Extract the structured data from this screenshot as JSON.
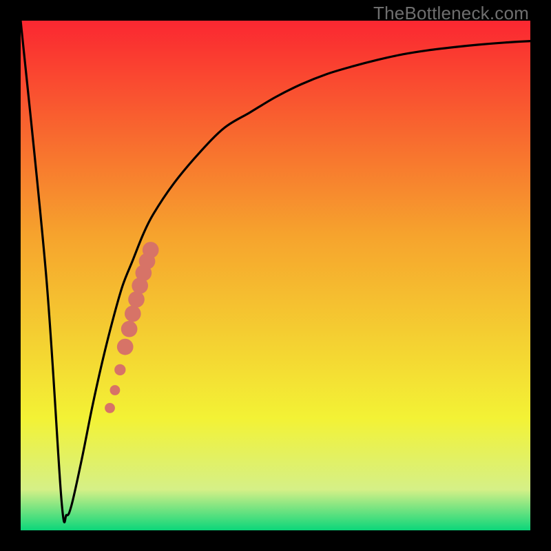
{
  "watermark": "TheBottleneck.com",
  "colors": {
    "curve": "#000000",
    "marker_fill": "#d77367",
    "gradient_top": "#fb2731",
    "gradient_mid1": "#f6a32d",
    "gradient_mid2": "#f3f235",
    "gradient_mid3": "#d5f087",
    "gradient_bottom": "#0bd67a"
  },
  "chart_data": {
    "type": "line",
    "title": "",
    "xlabel": "",
    "ylabel": "",
    "xlim": [
      0,
      100
    ],
    "ylim": [
      0,
      100
    ],
    "grid": false,
    "legend": false,
    "series": [
      {
        "name": "bottleneck-curve",
        "x": [
          0,
          5,
          8,
          9,
          10,
          12,
          14,
          16,
          18,
          20,
          22,
          24,
          26,
          30,
          35,
          40,
          45,
          50,
          55,
          60,
          65,
          70,
          75,
          80,
          85,
          90,
          95,
          100
        ],
        "y": [
          100,
          50,
          6,
          3,
          5,
          14,
          24,
          33,
          41,
          48,
          53,
          58,
          62,
          68,
          74,
          79,
          82,
          85,
          87.5,
          89.5,
          91,
          92.3,
          93.4,
          94.2,
          94.8,
          95.3,
          95.7,
          96
        ]
      }
    ],
    "markers": [
      {
        "name": "highlight-segment",
        "shape": "circle",
        "points": [
          {
            "x": 17.5,
            "y": 24.0,
            "r": 1.0
          },
          {
            "x": 18.5,
            "y": 27.5,
            "r": 1.0
          },
          {
            "x": 19.5,
            "y": 31.5,
            "r": 1.1
          },
          {
            "x": 20.5,
            "y": 36.0,
            "r": 1.6
          },
          {
            "x": 21.3,
            "y": 39.5,
            "r": 1.6
          },
          {
            "x": 22.0,
            "y": 42.5,
            "r": 1.6
          },
          {
            "x": 22.7,
            "y": 45.3,
            "r": 1.6
          },
          {
            "x": 23.4,
            "y": 48.0,
            "r": 1.6
          },
          {
            "x": 24.1,
            "y": 50.5,
            "r": 1.6
          },
          {
            "x": 24.8,
            "y": 52.8,
            "r": 1.6
          },
          {
            "x": 25.5,
            "y": 55.0,
            "r": 1.6
          }
        ]
      }
    ]
  }
}
